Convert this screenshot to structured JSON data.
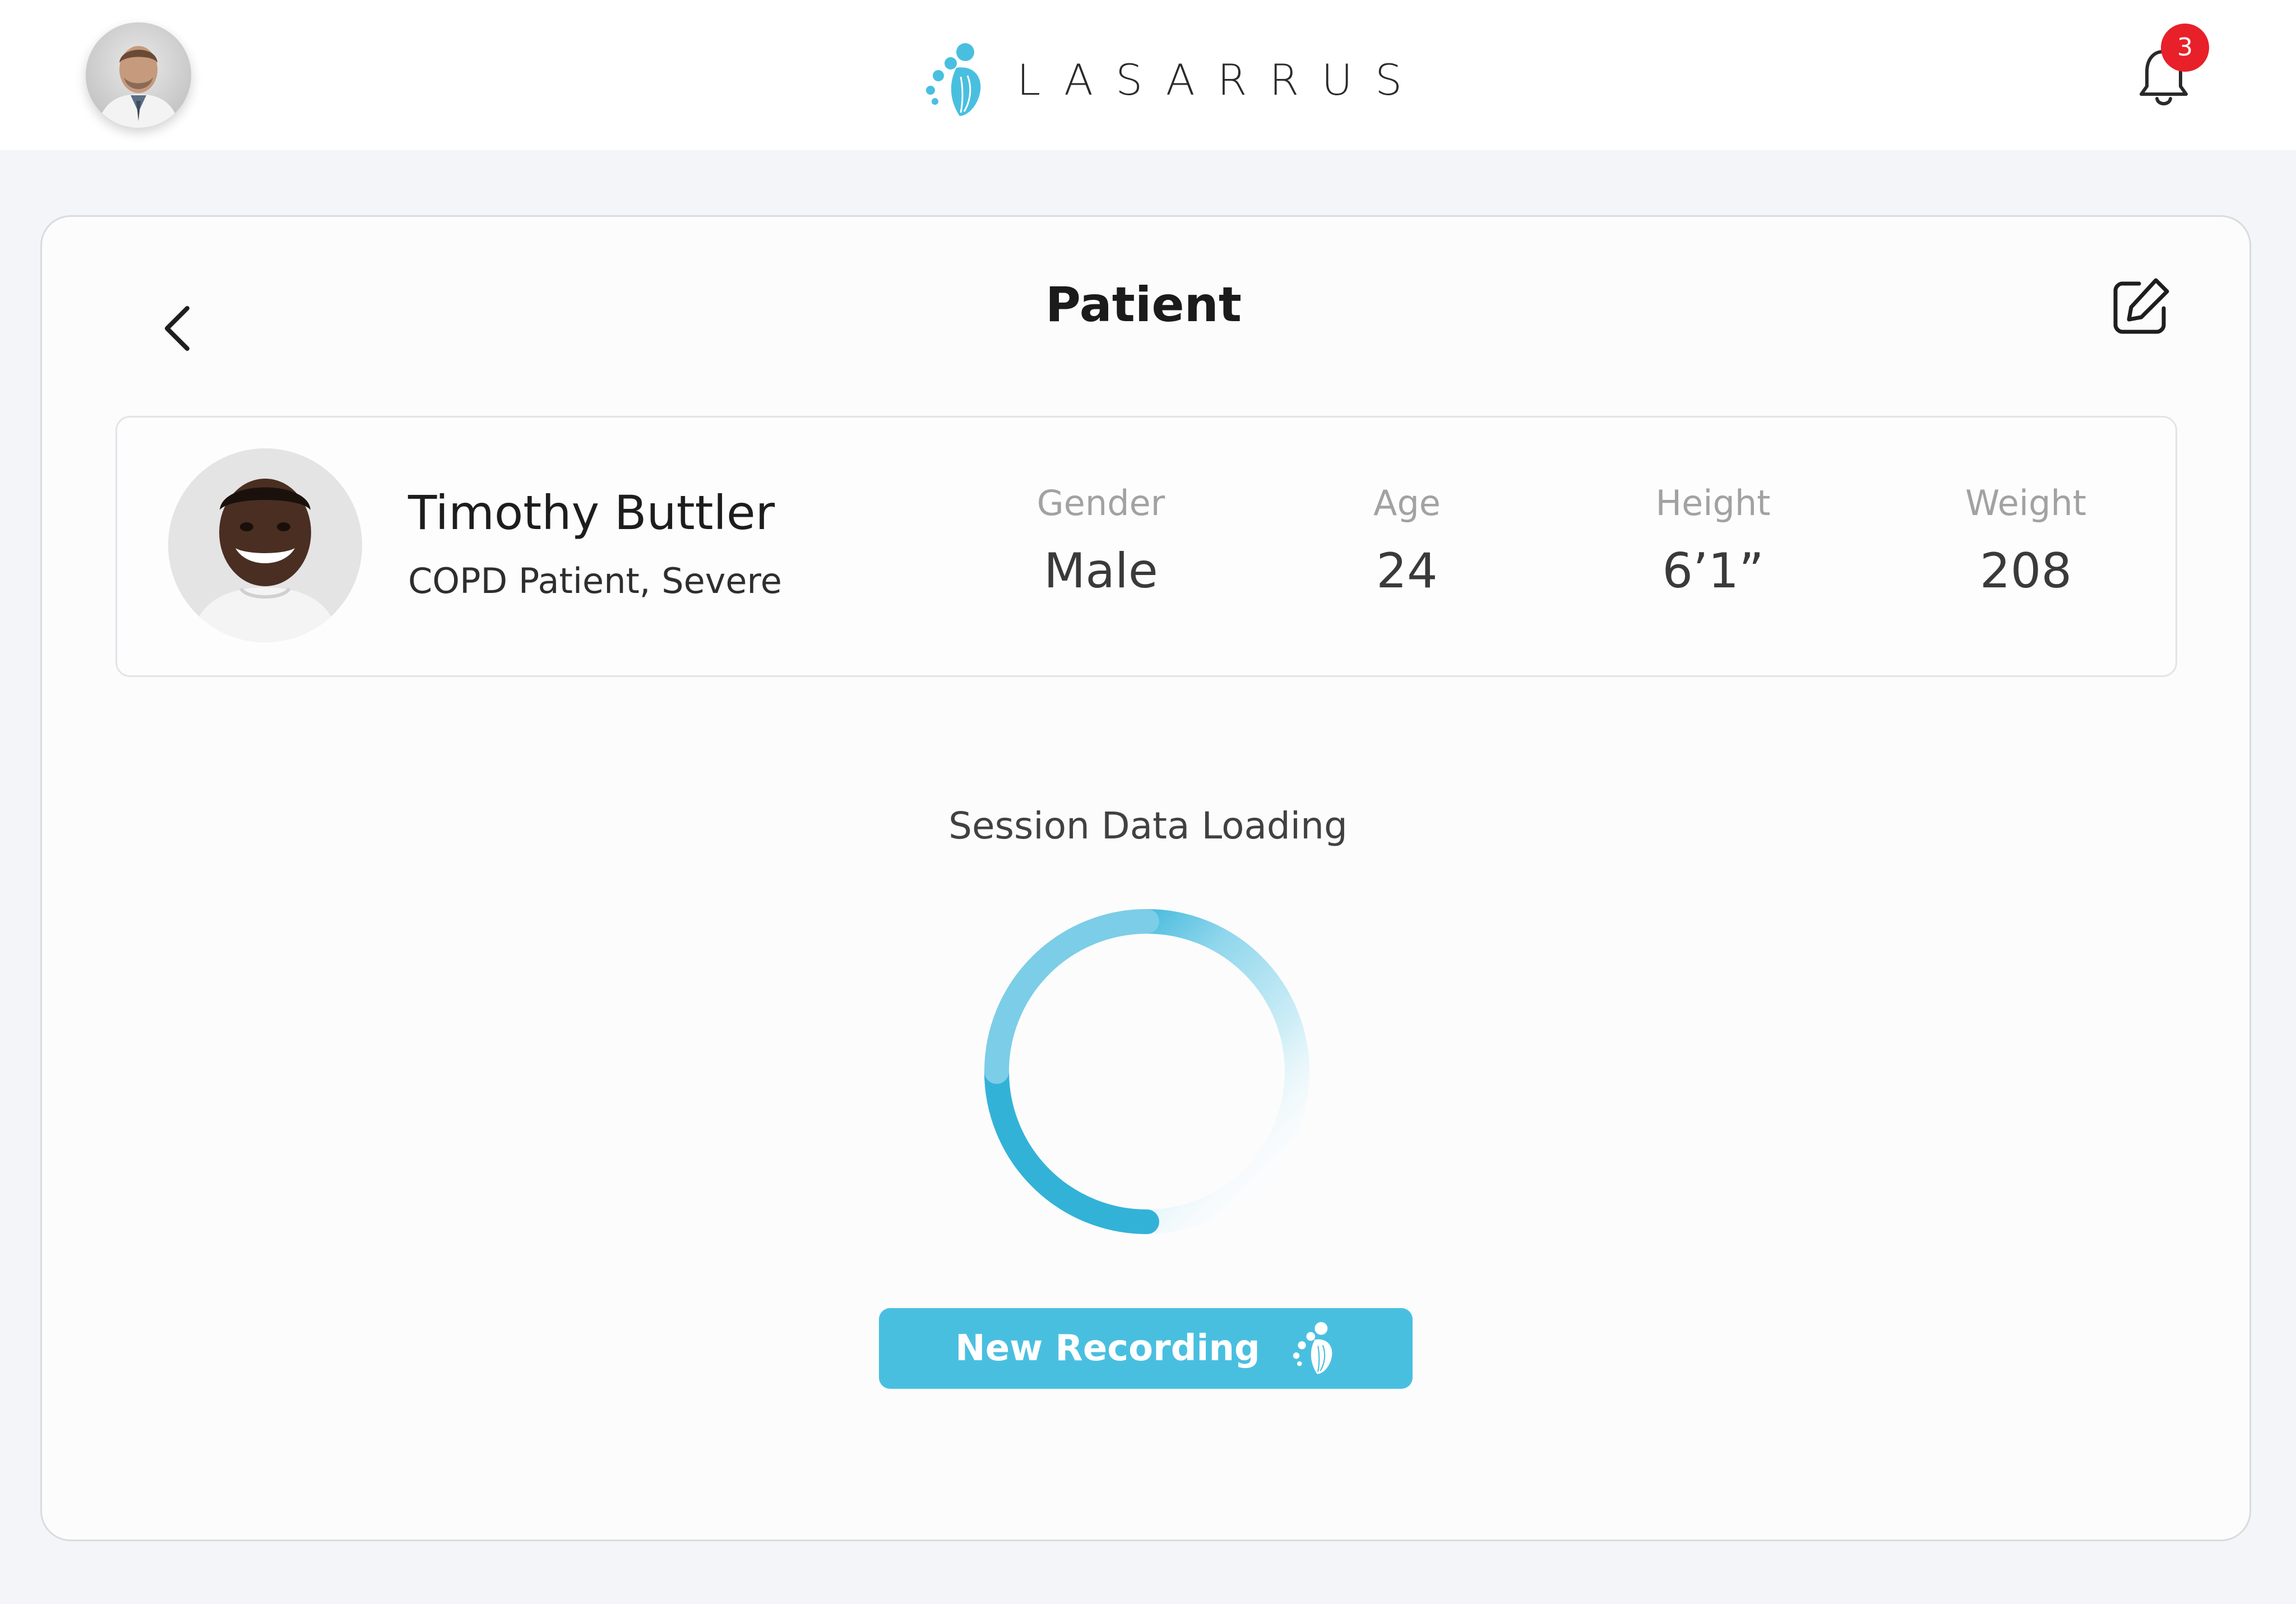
{
  "header": {
    "brand_name": "LASARRUS",
    "notification_count": "3",
    "user_avatar_icon": "doctor-avatar",
    "brand_icon": "lasarrus-logo-icon",
    "bell_icon": "bell-icon"
  },
  "page": {
    "title": "Patient",
    "back_icon": "chevron-left-icon",
    "edit_icon": "edit-icon"
  },
  "patient": {
    "name": "Timothy Buttler",
    "condition": "COPD Patient, Severe",
    "stats": [
      {
        "label": "Gender",
        "value": "Male"
      },
      {
        "label": "Age",
        "value": "24"
      },
      {
        "label": "Height",
        "value": "6’1”"
      },
      {
        "label": "Weight",
        "value": "208"
      }
    ]
  },
  "session": {
    "loading_label": "Session Data Loading"
  },
  "actions": {
    "new_recording_label": "New Recording"
  },
  "colors": {
    "accent": "#49bfe0",
    "notification_badge": "#e8202a",
    "page_background": "#f4f5f8",
    "card_background": "#fcfcfd"
  }
}
